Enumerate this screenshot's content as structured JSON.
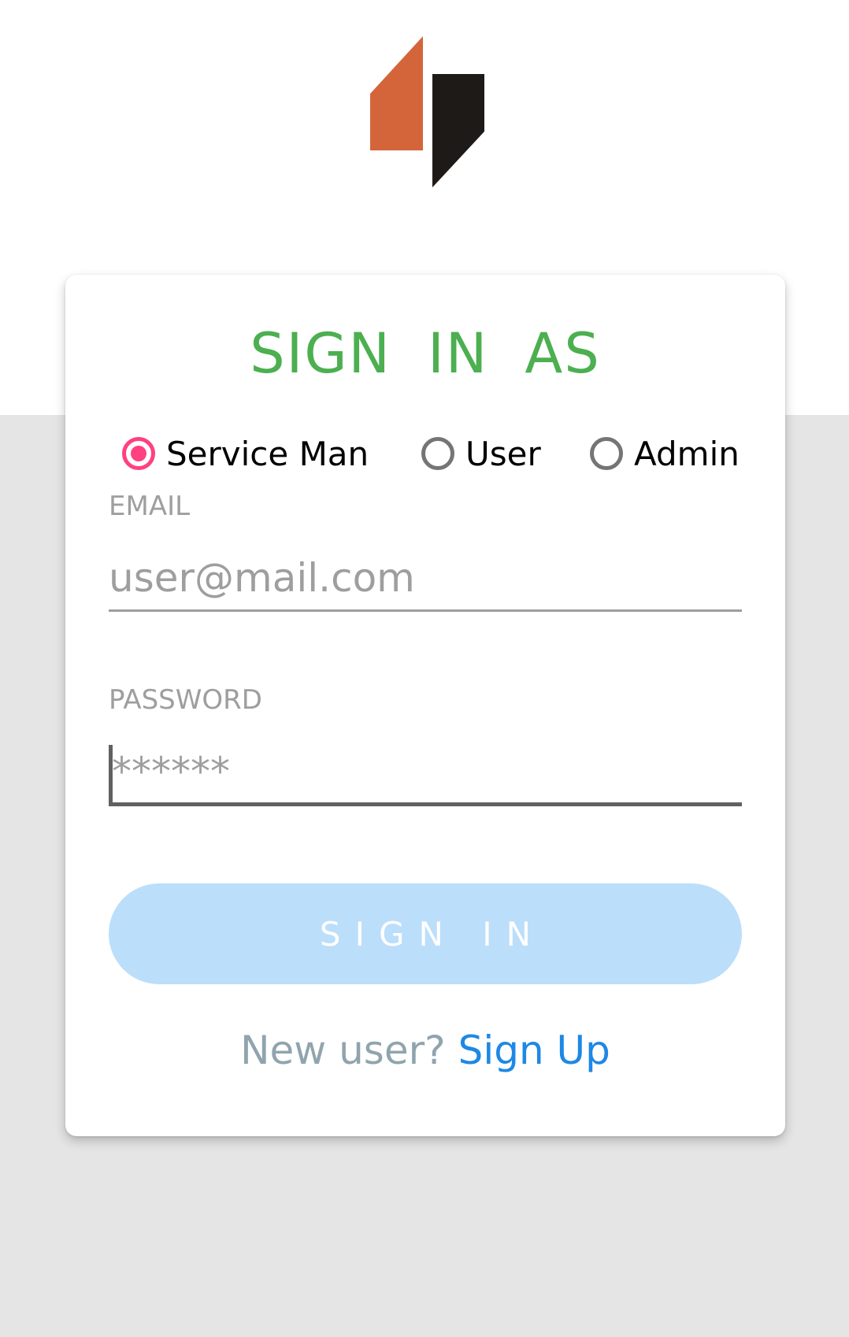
{
  "colors": {
    "title": "#4caf50",
    "radio_checked": "#ff4081",
    "radio_unchecked": "#757575",
    "button_bg": "#bbdefb",
    "link": "#1e88e5",
    "muted_text": "#90a4ae",
    "logo_orange": "#d4653a",
    "logo_black": "#1e1a18"
  },
  "logo": {
    "icon": "brand-logo-icon"
  },
  "form": {
    "title": "SIGN IN AS",
    "roles": [
      {
        "label": "Service Man",
        "checked": true
      },
      {
        "label": "User",
        "checked": false
      },
      {
        "label": "Admin",
        "checked": false
      }
    ],
    "email": {
      "label": "EMAIL",
      "placeholder": "user@mail.com",
      "value": ""
    },
    "password": {
      "label": "PASSWORD",
      "placeholder": "******",
      "value": ""
    },
    "submit_label": "SIGN IN",
    "signup_prompt": "New user?",
    "signup_link": "Sign Up"
  }
}
